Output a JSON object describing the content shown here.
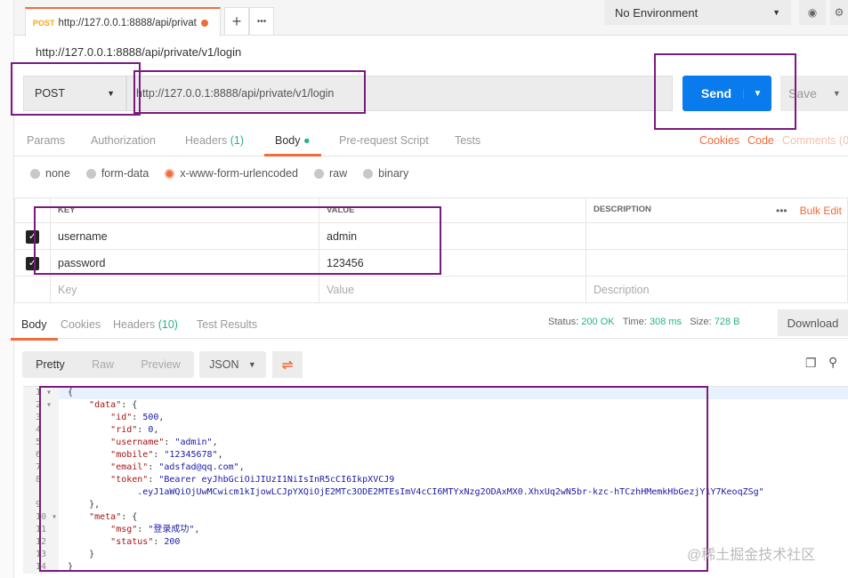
{
  "tabbar": {
    "tab_method": "POST",
    "tab_url": "http://127.0.0.1:8888/api/privat",
    "add": "+",
    "more": "•••"
  },
  "env": {
    "selected": "No Environment"
  },
  "page_url": "http://127.0.0.1:8888/api/private/v1/login",
  "request": {
    "method": "POST",
    "url": "http://127.0.0.1:8888/api/private/v1/login",
    "send": "Send",
    "save": "Save"
  },
  "req_tabs": {
    "params": "Params",
    "authorization": "Authorization",
    "headers": "Headers",
    "headers_count": "(1)",
    "body": "Body",
    "prerequest": "Pre-request Script",
    "tests": "Tests",
    "cookies": "Cookies",
    "code": "Code",
    "comments": "Comments (0"
  },
  "body_modes": [
    "none",
    "form-data",
    "x-www-form-urlencoded",
    "raw",
    "binary"
  ],
  "kv": {
    "headers": [
      "KEY",
      "VALUE",
      "DESCRIPTION"
    ],
    "bulk_edit": "Bulk Edit",
    "rows": [
      {
        "key": "username",
        "value": "admin"
      },
      {
        "key": "password",
        "value": "123456"
      }
    ],
    "placeholders": {
      "key": "Key",
      "value": "Value",
      "description": "Description"
    }
  },
  "resp_tabs": {
    "body": "Body",
    "cookies": "Cookies",
    "headers": "Headers",
    "headers_count": "(10)",
    "tests": "Test Results"
  },
  "status": {
    "status_label": "Status:",
    "status": "200 OK",
    "time_label": "Time:",
    "time": "308 ms",
    "size_label": "Size:",
    "size": "728 B",
    "download": "Download"
  },
  "view": {
    "pretty": "Pretty",
    "raw": "Raw",
    "preview": "Preview",
    "format": "JSON"
  },
  "code_lines": [
    [
      {
        "t": "p",
        "v": "{"
      }
    ],
    [
      {
        "t": "p",
        "v": "    "
      },
      {
        "t": "k",
        "v": "\"data\""
      },
      {
        "t": "p",
        "v": ": {"
      }
    ],
    [
      {
        "t": "p",
        "v": "        "
      },
      {
        "t": "k",
        "v": "\"id\""
      },
      {
        "t": "p",
        "v": ": "
      },
      {
        "t": "n",
        "v": "500"
      },
      {
        "t": "p",
        "v": ","
      }
    ],
    [
      {
        "t": "p",
        "v": "        "
      },
      {
        "t": "k",
        "v": "\"rid\""
      },
      {
        "t": "p",
        "v": ": "
      },
      {
        "t": "n",
        "v": "0"
      },
      {
        "t": "p",
        "v": ","
      }
    ],
    [
      {
        "t": "p",
        "v": "        "
      },
      {
        "t": "k",
        "v": "\"username\""
      },
      {
        "t": "p",
        "v": ": "
      },
      {
        "t": "s",
        "v": "\"admin\""
      },
      {
        "t": "p",
        "v": ","
      }
    ],
    [
      {
        "t": "p",
        "v": "        "
      },
      {
        "t": "k",
        "v": "\"mobile\""
      },
      {
        "t": "p",
        "v": ": "
      },
      {
        "t": "s",
        "v": "\"12345678\""
      },
      {
        "t": "p",
        "v": ","
      }
    ],
    [
      {
        "t": "p",
        "v": "        "
      },
      {
        "t": "k",
        "v": "\"email\""
      },
      {
        "t": "p",
        "v": ": "
      },
      {
        "t": "s",
        "v": "\"adsfad@qq.com\""
      },
      {
        "t": "p",
        "v": ","
      }
    ],
    [
      {
        "t": "p",
        "v": "        "
      },
      {
        "t": "k",
        "v": "\"token\""
      },
      {
        "t": "p",
        "v": ": "
      },
      {
        "t": "s",
        "v": "\"Bearer eyJhbGciOiJIUzI1NiIsInR5cCI6IkpXVCJ9"
      }
    ],
    [
      {
        "t": "s",
        "v": "             .eyJ1aWQiOjUwMCwicm1kIjowLCJpYXQiOjE2MTc3ODE2MTEsImV4cCI6MTYxNzg2ODAxMX0.XhxUq2wN5br-kzc-hTCzhHMemkHbGezjY1Y7KeoqZSg\""
      }
    ],
    [
      {
        "t": "p",
        "v": "    },"
      }
    ],
    [
      {
        "t": "p",
        "v": "    "
      },
      {
        "t": "k",
        "v": "\"meta\""
      },
      {
        "t": "p",
        "v": ": {"
      }
    ],
    [
      {
        "t": "p",
        "v": "        "
      },
      {
        "t": "k",
        "v": "\"msg\""
      },
      {
        "t": "p",
        "v": ": "
      },
      {
        "t": "s",
        "v": "\"登录成功\""
      },
      {
        "t": "p",
        "v": ","
      }
    ],
    [
      {
        "t": "p",
        "v": "        "
      },
      {
        "t": "k",
        "v": "\"status\""
      },
      {
        "t": "p",
        "v": ": "
      },
      {
        "t": "n",
        "v": "200"
      }
    ],
    [
      {
        "t": "p",
        "v": "    }"
      }
    ],
    [
      {
        "t": "p",
        "v": "}"
      }
    ]
  ],
  "line_numbers": [
    "1 ▾",
    "2 ▾",
    "3",
    "4",
    "5",
    "6",
    "7",
    "8",
    "",
    "9",
    "10 ▾",
    "11",
    "12",
    "13",
    "14"
  ],
  "watermark": "@稀土掘金技术社区"
}
